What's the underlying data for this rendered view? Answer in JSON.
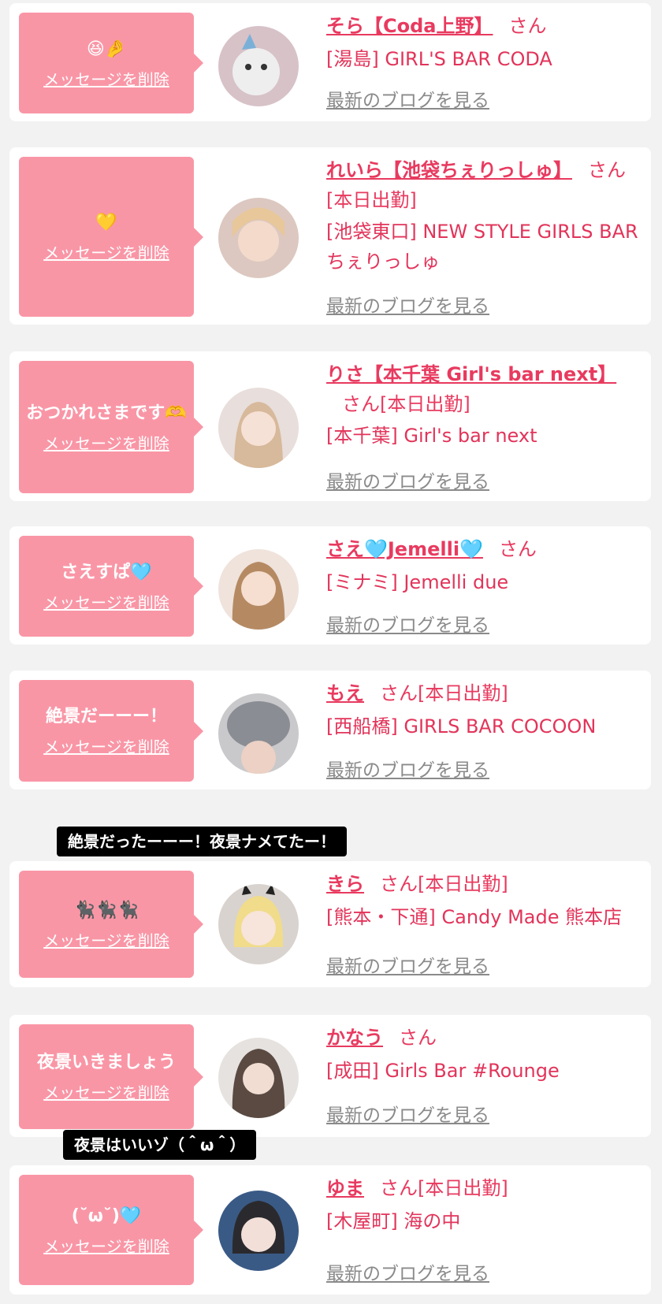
{
  "cards": [
    {
      "message": "😆🤌",
      "delete_label": "メッセージを削除",
      "name": "そら【Coda上野】",
      "suffix": "さん",
      "shop": "[湯島] GIRL'S BAR CODA",
      "blog": "最新のブログを見る"
    },
    {
      "message": "💛",
      "delete_label": "メッセージを削除",
      "name": "れいら【池袋ちぇりっしゅ】",
      "suffix": "さん[本日出勤]",
      "shop": "[池袋東口] NEW STYLE GIRLS BAR ちぇりっしゅ",
      "blog": "最新のブログを見る"
    },
    {
      "message": "おつかれさまです🫶",
      "delete_label": "メッセージを削除",
      "name": "りさ【本千葉 Girl's bar next】",
      "suffix": "さん[本日出勤]",
      "shop": "[本千葉] Girl's bar next",
      "blog": "最新のブログを見る"
    },
    {
      "message": "さえすぱ🩵",
      "delete_label": "メッセージを削除",
      "name": "さえ🩵Jemelli🩵",
      "suffix": "さん",
      "shop": "[ミナミ] Jemelli due",
      "blog": "最新のブログを見る"
    },
    {
      "message": "絶景だーーー！",
      "delete_label": "メッセージを削除",
      "name": "もえ",
      "suffix": "さん[本日出勤]",
      "shop": "[西船橋] GIRLS BAR COCOON",
      "blog": "最新のブログを見る"
    },
    {
      "message": "🐈‍⬛🐈‍⬛🐈‍⬛",
      "delete_label": "メッセージを削除",
      "name": "きら",
      "suffix": "さん[本日出勤]",
      "shop": "[熊本・下通] Candy Made 熊本店",
      "blog": "最新のブログを見る"
    },
    {
      "message": "夜景いきましょう",
      "delete_label": "メッセージを削除",
      "name": "かなう",
      "suffix": "さん",
      "shop": "[成田] Girls Bar #Rounge",
      "blog": "最新のブログを見る"
    },
    {
      "message": "(˘ω˘)🩵",
      "delete_label": "メッセージを削除",
      "name": "ゆま",
      "suffix": "さん[本日出勤]",
      "shop": "[木屋町] 海の中",
      "blog": "最新のブログを見る"
    }
  ],
  "captions": [
    "絶景だったーーー！夜景ナメてたー！",
    "夜景はいいゾ（＾ω＾）"
  ],
  "colors": {
    "accent": "#e83a5f",
    "bubble": "#f996a6",
    "background": "#f2f2f3",
    "muted_link": "#8a8a8a"
  }
}
